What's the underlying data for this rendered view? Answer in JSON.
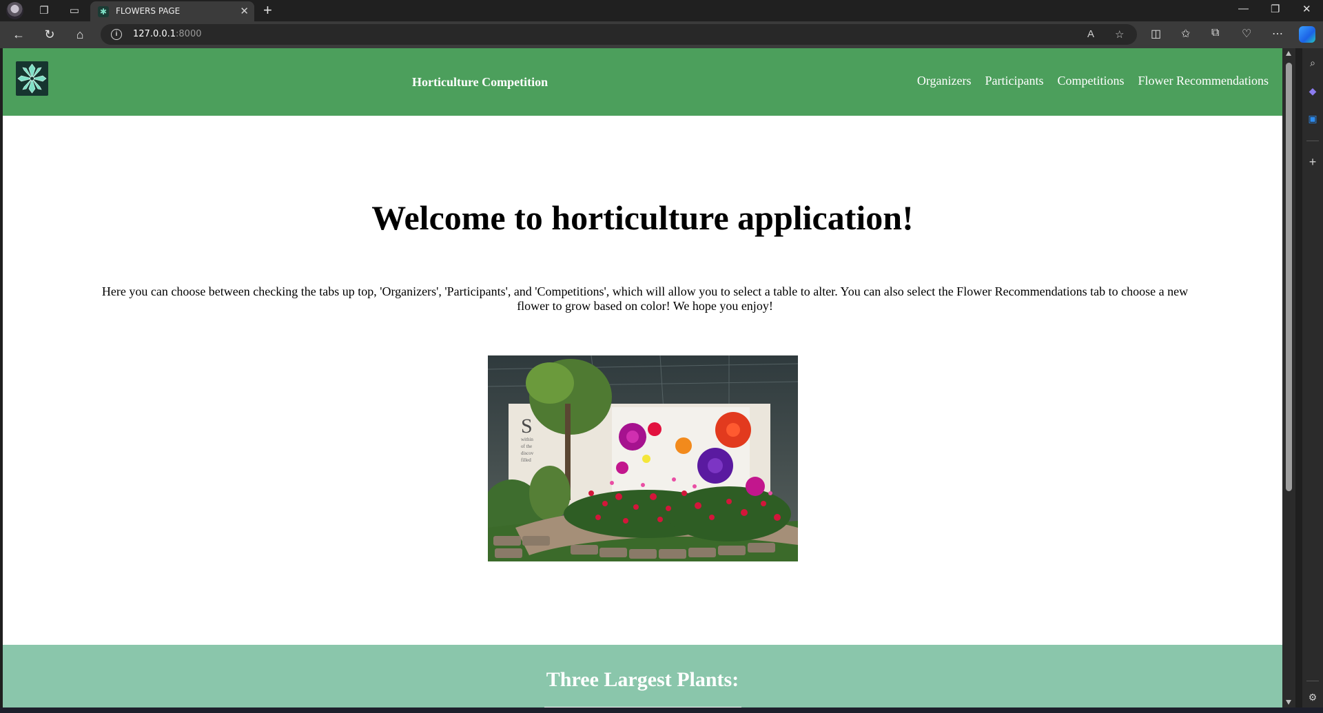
{
  "browser": {
    "tab_title": "FLOWERS PAGE",
    "tab_close": "✕",
    "new_tab": "+",
    "url_host": "127.0.0.1",
    "url_port": ":8000",
    "read_aloud_label": "A",
    "window_controls": {
      "minimize": "—",
      "restore": "❐",
      "close": "✕"
    }
  },
  "site": {
    "brand_title": "Horticulture Competition",
    "nav": [
      {
        "label": "Organizers"
      },
      {
        "label": "Participants"
      },
      {
        "label": "Competitions"
      },
      {
        "label": "Flower Recommendations"
      }
    ],
    "heading": "Welcome to horticulture application!",
    "intro": "Here you can choose between checking the tabs up top, 'Organizers', 'Participants', and 'Competitions', which will allow you to select a table to alter. You can also select the Flower Recommendations tab to choose a new flower to grow based on color! We hope you enjoy!",
    "section_heading": "Three Largest Plants:"
  },
  "colors": {
    "nav_green": "#4c9f5c",
    "section_green": "#8ac6ab",
    "logo_bg": "#16352f",
    "logo_leaf": "#7fe0c6"
  }
}
